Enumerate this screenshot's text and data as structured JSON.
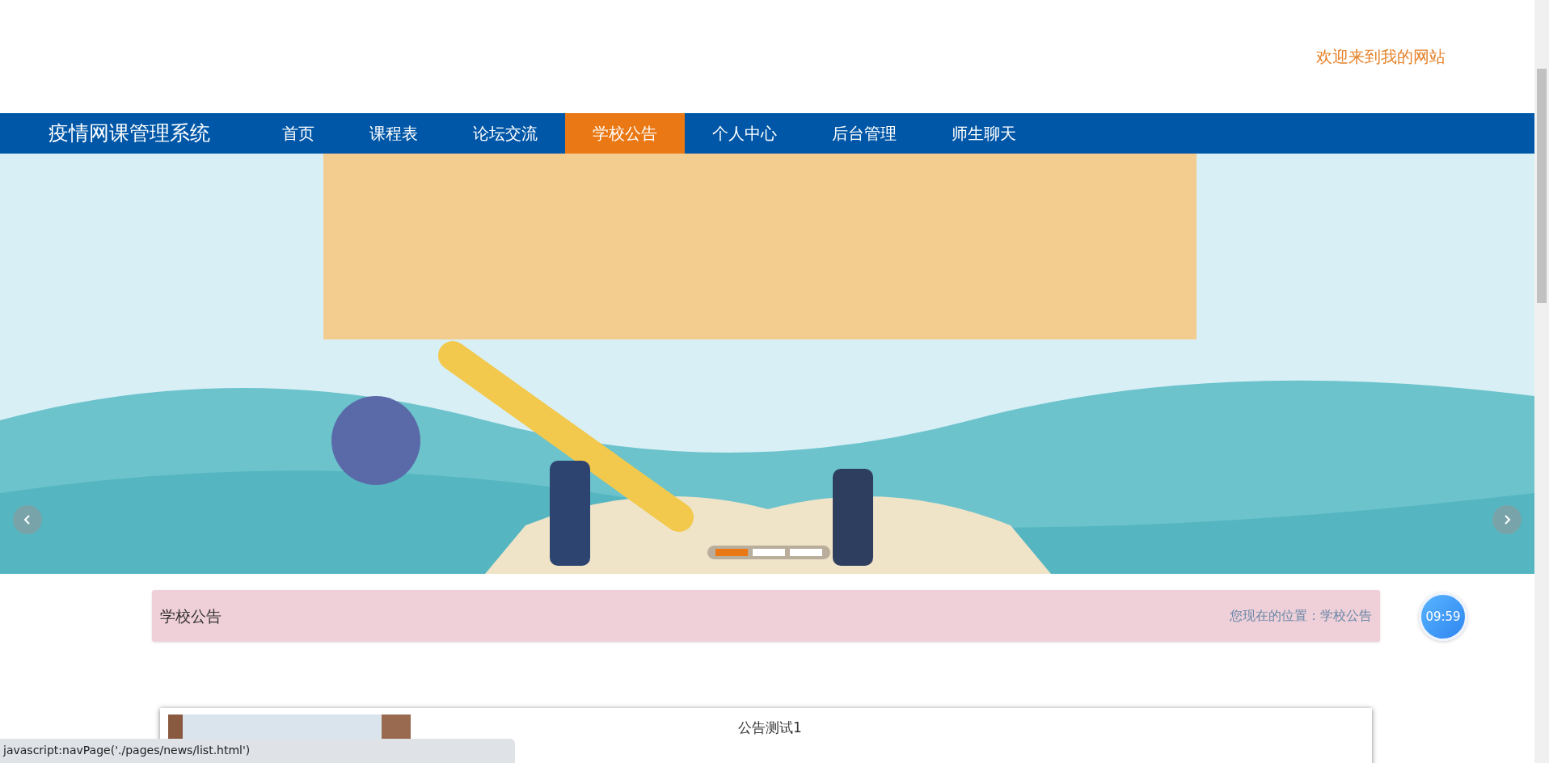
{
  "header": {
    "welcome": "欢迎来到我的网站"
  },
  "navbar": {
    "brand": "疫情网课管理系统",
    "items": [
      {
        "label": "首页",
        "selected": false
      },
      {
        "label": "课程表",
        "selected": false
      },
      {
        "label": "论坛交流",
        "selected": false
      },
      {
        "label": "学校公告",
        "selected": true
      },
      {
        "label": "个人中心",
        "selected": false
      },
      {
        "label": "后台管理",
        "selected": false
      },
      {
        "label": "师生聊天",
        "selected": false
      }
    ]
  },
  "carousel": {
    "indicators": [
      {
        "selected": true
      },
      {
        "selected": false
      },
      {
        "selected": false
      }
    ]
  },
  "breadcrumb": {
    "title": "学校公告",
    "location": "您现在的位置：学校公告"
  },
  "clock": {
    "time": "09:59"
  },
  "news": [
    {
      "title": "公告测试1"
    }
  ],
  "status_bar": {
    "url": "javascript:navPage('./pages/news/list.html')"
  }
}
